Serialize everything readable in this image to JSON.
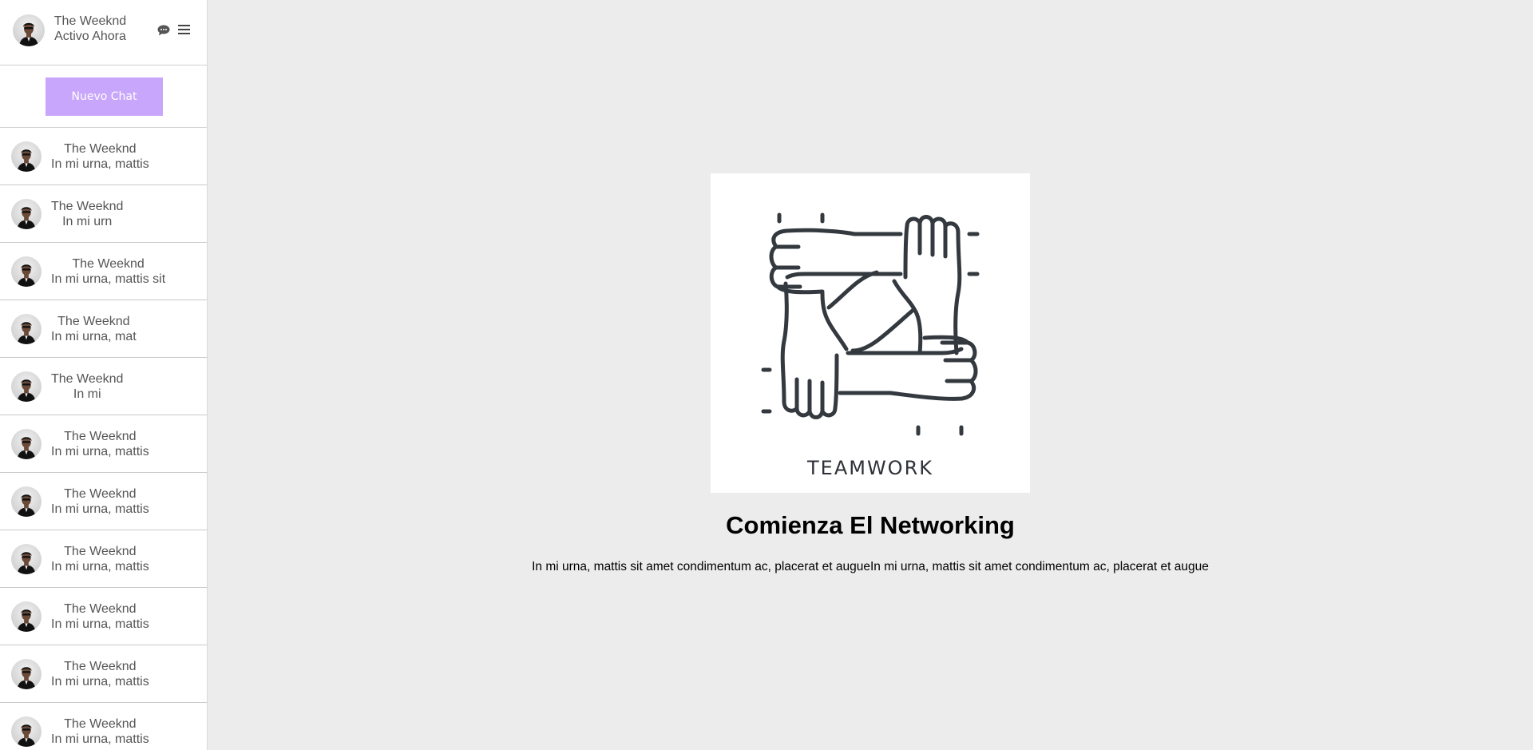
{
  "header": {
    "user_name": "The Weeknd",
    "status": "Activo Ahora",
    "icons": [
      "chat-bubble-icon",
      "hamburger-menu-icon"
    ]
  },
  "new_chat_label": "Nuevo Chat",
  "chats": [
    {
      "name": "The Weeknd",
      "preview": "In mi urna, mattis"
    },
    {
      "name": "The Weeknd",
      "preview": "In mi urn"
    },
    {
      "name": "The Weeknd",
      "preview": "In mi urna, mattis sit"
    },
    {
      "name": "The Weeknd",
      "preview": "In mi urna, mat"
    },
    {
      "name": "The Weeknd",
      "preview": "In mi"
    },
    {
      "name": "The Weeknd",
      "preview": "In mi urna, mattis"
    },
    {
      "name": "The Weeknd",
      "preview": "In mi urna, mattis"
    },
    {
      "name": "The Weeknd",
      "preview": "In mi urna, mattis"
    },
    {
      "name": "The Weeknd",
      "preview": "In mi urna, mattis"
    },
    {
      "name": "The Weeknd",
      "preview": "In mi urna, mattis"
    },
    {
      "name": "The Weeknd",
      "preview": "In mi urna, mattis"
    }
  ],
  "main": {
    "image_caption": "TEAMWORK",
    "title": "Comienza El Networking",
    "subtitle": "In mi urna, mattis sit amet condimentum ac, placerat et augueIn mi urna, mattis sit amet condimentum ac, placerat et augue"
  },
  "colors": {
    "accent": "#c8a6fb",
    "background": "#ececec",
    "sidebar": "#ffffff",
    "text_muted": "#555555",
    "icon_stroke": "#33393f"
  }
}
